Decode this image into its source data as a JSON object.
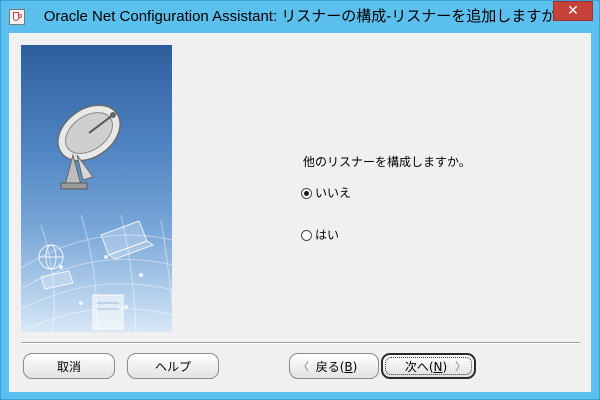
{
  "window": {
    "title": "Oracle Net Configuration Assistant: リスナーの構成-リスナーを追加しますか",
    "close_label": "✕"
  },
  "main": {
    "question": "他のリスナーを構成しますか。",
    "options": [
      {
        "label": "いいえ",
        "selected": true
      },
      {
        "label": "はい",
        "selected": false
      }
    ]
  },
  "buttons": {
    "cancel": "取消",
    "help": "ヘルプ",
    "back_prefix": "戻る(",
    "back_key": "B",
    "back_suffix": ")",
    "next_prefix": "次へ(",
    "next_key": "N",
    "next_suffix": ")",
    "back_arrow": "〈",
    "next_arrow": "〉"
  },
  "icons": {
    "app": "java-cup-icon",
    "close": "close-icon",
    "side": "satellite-dish-network-illustration"
  }
}
